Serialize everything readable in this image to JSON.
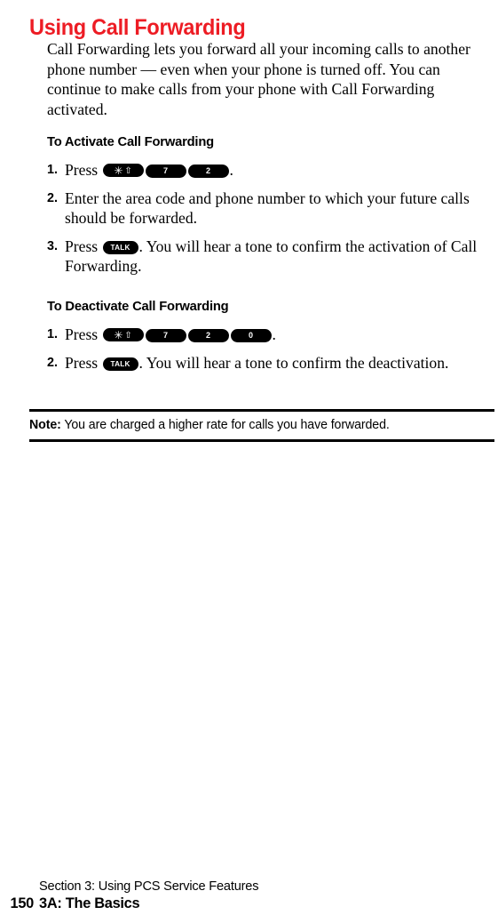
{
  "title": "Using Call Forwarding",
  "title_color": "#ED1C24",
  "intro": "Call Forwarding lets you forward all your incoming calls to another phone number — even when your phone is turned off. You can continue to make calls from your phone with Call Forwarding activated.",
  "activate": {
    "heading": "To Activate Call Forwarding",
    "steps": [
      {
        "number": "1.",
        "prefix": "Press ",
        "keys": [
          "star-shift",
          "7",
          "2"
        ],
        "suffix": "."
      },
      {
        "number": "2.",
        "prefix": "Enter the area code and phone number to which your future calls should be forwarded.",
        "keys": [],
        "suffix": ""
      },
      {
        "number": "3.",
        "prefix": "Press ",
        "keys": [
          "TALK"
        ],
        "suffix": ". You will hear a tone to confirm the activation of Call Forwarding."
      }
    ]
  },
  "deactivate": {
    "heading": "To Deactivate Call Forwarding",
    "steps": [
      {
        "number": "1.",
        "prefix": "Press ",
        "keys": [
          "star-shift",
          "7",
          "2",
          "0"
        ],
        "suffix": "."
      },
      {
        "number": "2.",
        "prefix": "Press ",
        "keys": [
          "TALK"
        ],
        "suffix": ". You will hear a tone to confirm the deactivation."
      }
    ]
  },
  "note": {
    "label": "Note:",
    "text": " You are charged a higher rate for calls you have forwarded."
  },
  "footer": {
    "section": "Section 3: Using PCS Service Features",
    "page_number": "150",
    "chapter": "3A: The Basics"
  },
  "keys": {
    "star_glyph": "✳",
    "shift_glyph": "⇧",
    "talk_label": "TALK",
    "seven_label": "7",
    "two_label": "2",
    "zero_label": "0"
  }
}
